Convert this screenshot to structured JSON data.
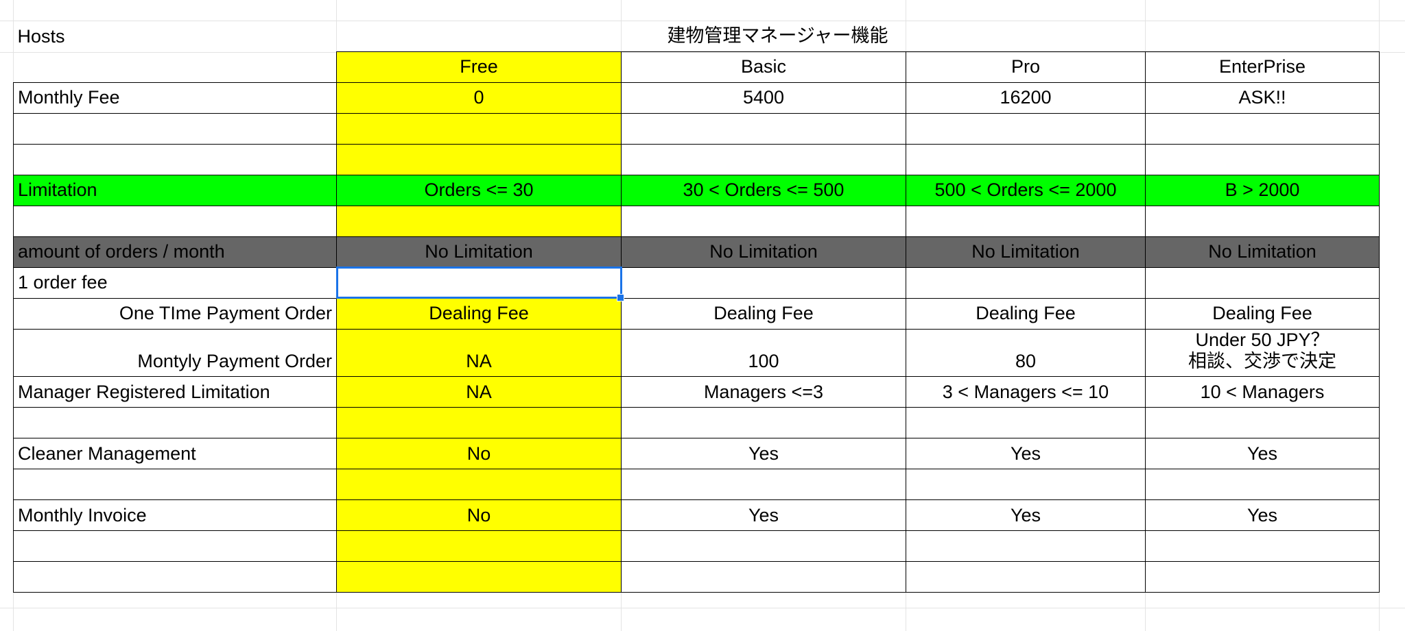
{
  "header": {
    "hosts_label": "Hosts",
    "section_title": "建物管理マネージャー機能"
  },
  "plans": [
    "Free",
    "Basic",
    "Pro",
    "EnterPrise"
  ],
  "rows": {
    "monthly_fee": {
      "label": "Monthly Fee",
      "values": [
        "0",
        "5400",
        "16200",
        "ASK!!"
      ]
    },
    "limitation": {
      "label": "Limitation",
      "values": [
        "Orders <= 30",
        "30 < Orders <= 500",
        "500 < Orders <= 2000",
        "B > 2000"
      ]
    },
    "amount_orders": {
      "label": "amount of orders / month",
      "values": [
        "No Limitation",
        "No Limitation",
        "No Limitation",
        "No Limitation"
      ]
    },
    "order_fee": {
      "label": "1 order fee"
    },
    "one_time": {
      "label": "One TIme Payment Order",
      "values": [
        "Dealing Fee",
        "Dealing Fee",
        "Dealing Fee",
        "Dealing Fee"
      ]
    },
    "monthly_payment": {
      "label": "Montyly Payment Order",
      "values": [
        "NA",
        "100",
        "80",
        "Under 50 JPY？",
        "相談、交渉で決定"
      ]
    },
    "manager_limit": {
      "label": "Manager Registered Limitation",
      "values": [
        "NA",
        "Managers <=3",
        "3 < Managers <= 10",
        "10 < Managers"
      ]
    },
    "cleaner": {
      "label": "Cleaner Management",
      "values": [
        "No",
        "Yes",
        "Yes",
        "Yes"
      ]
    },
    "invoice": {
      "label": "Monthly Invoice",
      "values": [
        "No",
        "Yes",
        "Yes",
        "Yes"
      ]
    }
  },
  "colors": {
    "free_column": "#ffff00",
    "limitation_row": "#00ff00",
    "orders_row": "#666666",
    "selection": "#1a73e8"
  }
}
